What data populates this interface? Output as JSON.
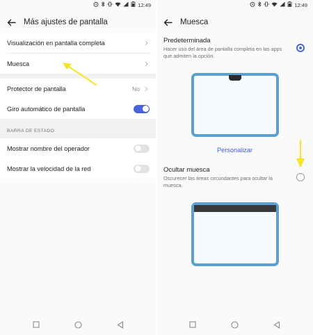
{
  "status_bar": {
    "time": "12:49"
  },
  "left": {
    "title": "Más ajustes de pantalla",
    "rows": [
      {
        "label": "Visualización en pantalla completa"
      },
      {
        "label": "Muesca"
      },
      {
        "label": "Protector de pantalla",
        "value": "No"
      },
      {
        "label": "Giro automático de pantalla",
        "toggle": "on"
      }
    ],
    "section_header": "BARRA DE ESTADO",
    "status_rows": [
      {
        "label": "Mostrar nombre del operador",
        "toggle": "off"
      },
      {
        "label": "Mostrar la velocidad de la red",
        "toggle": "off"
      }
    ]
  },
  "right": {
    "title": "Muesca",
    "option_default": {
      "title": "Predeterminada",
      "description": "Hacer uso del área de pantalla completa en las apps que admiten la opción.",
      "selected": true
    },
    "customize_label": "Personalizar",
    "option_hide": {
      "title": "Ocultar muesca",
      "description": "Oscurecer las áreas circundantes para ocultar la muesca.",
      "selected": false
    }
  },
  "colors": {
    "accent": "#4a63d8",
    "highlight_arrow": "#f2e52b",
    "phone_frame": "#5aa0d0"
  },
  "icons": {
    "back": "arrow-left-icon",
    "chevron": "chevron-right-icon",
    "nav": [
      "square-icon",
      "circle-icon",
      "triangle-back-icon"
    ]
  }
}
